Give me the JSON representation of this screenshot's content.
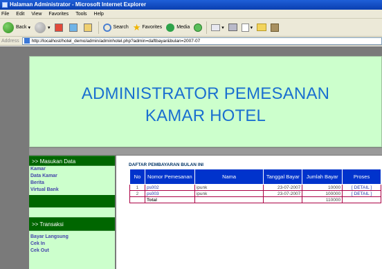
{
  "window": {
    "title": "Halaman Administrator - Microsoft Internet Explorer"
  },
  "menu": [
    "File",
    "Edit",
    "View",
    "Favorites",
    "Tools",
    "Help"
  ],
  "toolbar": {
    "back": "Back",
    "search": "Search",
    "favorites": "Favorites",
    "media": "Media"
  },
  "address": {
    "label": "Address",
    "url": "http://localhost/hotel_demo/admin/adminhotel.php?admin=daftbayar&bulan=2007-07"
  },
  "header": {
    "line1": "ADMINISTRATOR PEMESANAN",
    "line2": "KAMAR HOTEL"
  },
  "sidebar": {
    "section1": {
      "title": ">> Masukan Data",
      "items": [
        "Kamar",
        "Data Kamar",
        "Berita",
        "Virtual Bank"
      ]
    },
    "section2": {
      "title": ">> Transaksi",
      "items": [
        "Bayar Langsung",
        "Cek In",
        "Cek Out"
      ]
    }
  },
  "table": {
    "title": "DAFTAR PEMBAYARAN BULAN INI",
    "headers": [
      "No",
      "Nomor Pemesanan",
      "Nama",
      "Tanggal Bayar",
      "Jumlah Bayar",
      "Proses"
    ],
    "rows": [
      {
        "no": "1",
        "kode": "ps002",
        "nama": "ipunk",
        "tanggal": "23-07-2007",
        "jumlah": "10000",
        "proses": "[ DETAIL ]"
      },
      {
        "no": "2",
        "kode": "ps003",
        "nama": "ipunk",
        "tanggal": "23-07-2007",
        "jumlah": "100000",
        "proses": "[ DETAIL ]"
      }
    ],
    "total_label": "Total",
    "total_value": "110000"
  }
}
